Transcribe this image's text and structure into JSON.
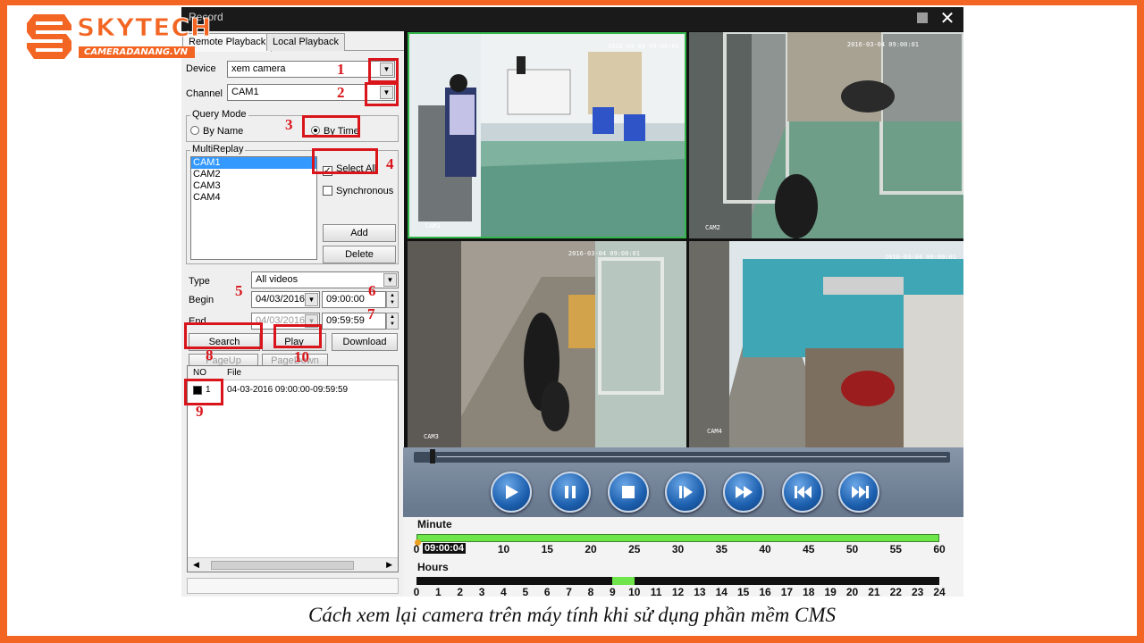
{
  "brand": {
    "name": "SKYTECH",
    "site": "CAMERADANANG.VN",
    "color": "#f26522"
  },
  "window": {
    "title": "Record",
    "close_label": "✕"
  },
  "tabs": [
    {
      "label": "Remote Playback",
      "active": true
    },
    {
      "label": "Local Playback",
      "active": false
    }
  ],
  "form": {
    "device_label": "Device",
    "device_value": "xem camera",
    "channel_label": "Channel",
    "channel_value": "CAM1",
    "query_mode_title": "Query Mode",
    "by_name_label": "By Name",
    "by_time_label": "By Time",
    "query_mode_selected": "By Time",
    "multireplay_title": "MultiReplay",
    "cameras": [
      "CAM1",
      "CAM2",
      "CAM3",
      "CAM4"
    ],
    "selected_camera": "CAM1",
    "select_all_label": "Select All",
    "select_all_checked": true,
    "synchronous_label": "Synchronous",
    "synchronous_checked": false,
    "add_label": "Add",
    "delete_label": "Delete",
    "type_label": "Type",
    "type_value": "All videos",
    "begin_label": "Begin",
    "begin_date": "04/03/2016",
    "begin_time": "09:00:00",
    "end_label": "End",
    "end_date": "04/03/2016",
    "end_time": "09:59:59",
    "search_label": "Search",
    "play_label": "Play",
    "download_label": "Download",
    "pageup_label": "PageUp",
    "pagedown_label": "PageDown"
  },
  "files": {
    "col_no": "NO",
    "col_file": "File",
    "rows": [
      {
        "no": "1",
        "file": "04-03-2016 09:00:00-09:59:59"
      }
    ]
  },
  "annotations": [
    "1",
    "2",
    "3",
    "4",
    "5",
    "6",
    "7",
    "8",
    "9",
    "10"
  ],
  "videos": [
    {
      "camera": "CAM1",
      "timestamp": "2016-03-04 09:00:01"
    },
    {
      "camera": "CAM2",
      "timestamp": "2016-03-04 09:00:01"
    },
    {
      "camera": "CAM3",
      "timestamp": "2016-03-04 09:00:01"
    },
    {
      "camera": "CAM4",
      "timestamp": "2016-03-04 09:00:01"
    }
  ],
  "player": {
    "buttons": [
      "play-icon",
      "pause-icon",
      "stop-icon",
      "step-icon",
      "fast-forward-icon",
      "previous-icon",
      "next-icon"
    ],
    "minute_title": "Minute",
    "minute_ticks": [
      "0",
      "10",
      "15",
      "20",
      "25",
      "30",
      "35",
      "40",
      "45",
      "50",
      "55",
      "60"
    ],
    "current_time": "09:00:04",
    "hours_title": "Hours",
    "hour_ticks": [
      "0",
      "1",
      "2",
      "3",
      "4",
      "5",
      "6",
      "7",
      "8",
      "9",
      "10",
      "11",
      "12",
      "13",
      "14",
      "15",
      "16",
      "17",
      "18",
      "19",
      "20",
      "21",
      "22",
      "23",
      "24"
    ],
    "recorded_hour": 9,
    "timeline_color": "#6ee64b"
  },
  "caption": "Cách xem lại camera trên máy tính khi sử dụng phần mềm CMS"
}
